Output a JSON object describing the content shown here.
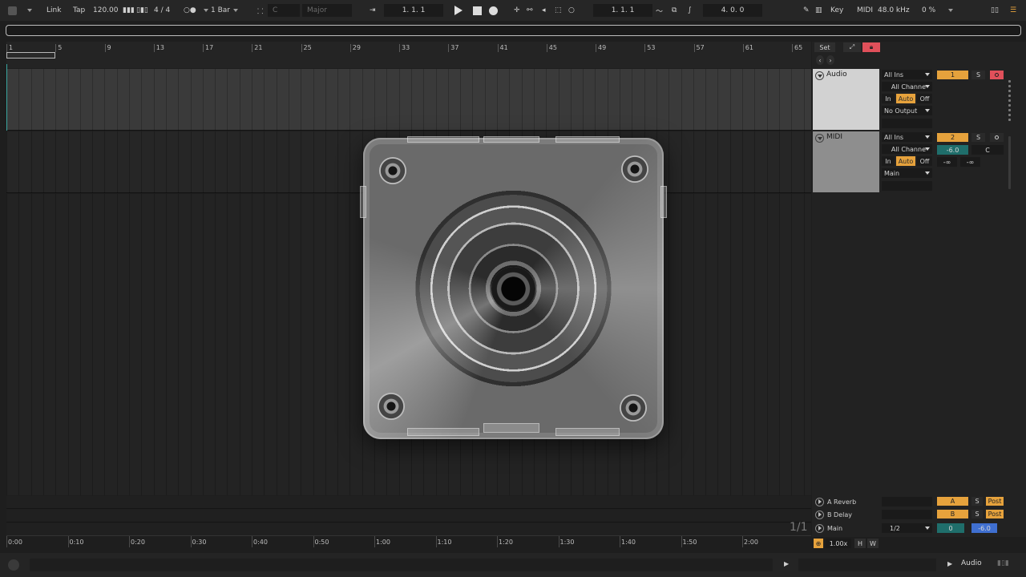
{
  "topbar": {
    "link": "Link",
    "tap": "Tap",
    "tempo": "120.00",
    "signature": "4 / 4",
    "quantize": "1 Bar",
    "key_root": "C",
    "scale": "Major",
    "position": "1.   1.   1",
    "loop_start": "1.   1.   1",
    "loop_length": "4.   0.   0",
    "key_label": "Key",
    "midi_label": "MIDI",
    "sample_rate": "48.0 kHz",
    "cpu": "0 %"
  },
  "ruler": {
    "bars": [
      "1",
      "5",
      "9",
      "13",
      "17",
      "21",
      "25",
      "29",
      "33",
      "37",
      "41",
      "45",
      "49",
      "53",
      "57",
      "61",
      "65"
    ]
  },
  "time_ruler": {
    "labels": [
      "0:00",
      "0:10",
      "0:20",
      "0:30",
      "0:40",
      "0:50",
      "1:00",
      "1:10",
      "1:20",
      "1:30",
      "1:40",
      "1:50",
      "2:00"
    ]
  },
  "page_indicator": "1/1",
  "panel": {
    "set_label": "Set"
  },
  "tracks": [
    {
      "name": "Audio",
      "input": "All Ins",
      "channel": "All Channe",
      "monitor_in": "In",
      "monitor_auto": "Auto",
      "monitor_off": "Off",
      "output": "No Output",
      "number": "1",
      "solo": "S"
    },
    {
      "name": "MIDI",
      "input": "All Ins",
      "channel": "All Channe",
      "monitor_in": "In",
      "monitor_auto": "Auto",
      "monitor_off": "Off",
      "output": "Main",
      "number": "2",
      "solo": "S",
      "volume": "-6.0",
      "pan": "C",
      "send_a": "-∞",
      "send_b": "-∞"
    }
  ],
  "returns": [
    {
      "name": "A Reverb",
      "letter": "A",
      "solo": "S",
      "post": "Post"
    },
    {
      "name": "B Delay",
      "letter": "B",
      "solo": "S",
      "post": "Post"
    }
  ],
  "main": {
    "name": "Main",
    "cue": "1/2",
    "number": "0",
    "volume": "-6.0"
  },
  "zoom": {
    "value": "1.00x",
    "h": "H",
    "w": "W"
  },
  "status": {
    "track_type": "Audio"
  },
  "colors": {
    "accent": "#e6a23c",
    "arm": "#e0505a",
    "teal": "#3aa7a0",
    "blue": "#3f6fd0"
  }
}
